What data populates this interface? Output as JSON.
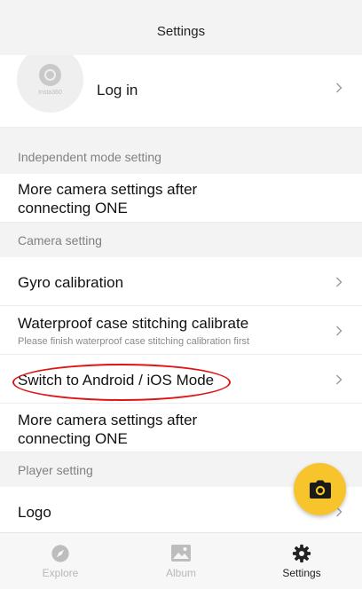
{
  "header": {
    "title": "Settings"
  },
  "account": {
    "login_label": "Log in",
    "avatar_brand": "Insta360"
  },
  "sections": {
    "independent": {
      "header": "Independent mode setting",
      "note": "More camera settings after connecting ONE"
    },
    "camera": {
      "header": "Camera setting",
      "gyro": "Gyro calibration",
      "waterproof_title": "Waterproof case stitching calibrate",
      "waterproof_sub": "Please finish waterproof case stitching calibration first",
      "switch_mode": "Switch to Android / iOS Mode",
      "note": "More camera settings after connecting ONE"
    },
    "player": {
      "header": "Player setting",
      "logo": "Logo"
    }
  },
  "annotation": {
    "color": "#e01414"
  },
  "fab": {
    "icon": "camera-icon",
    "color": "#f8c42b"
  },
  "tabs": [
    {
      "label": "Explore",
      "icon": "compass-icon",
      "active": false
    },
    {
      "label": "Album",
      "icon": "image-icon",
      "active": false
    },
    {
      "label": "Settings",
      "icon": "gear-icon",
      "active": true
    }
  ]
}
